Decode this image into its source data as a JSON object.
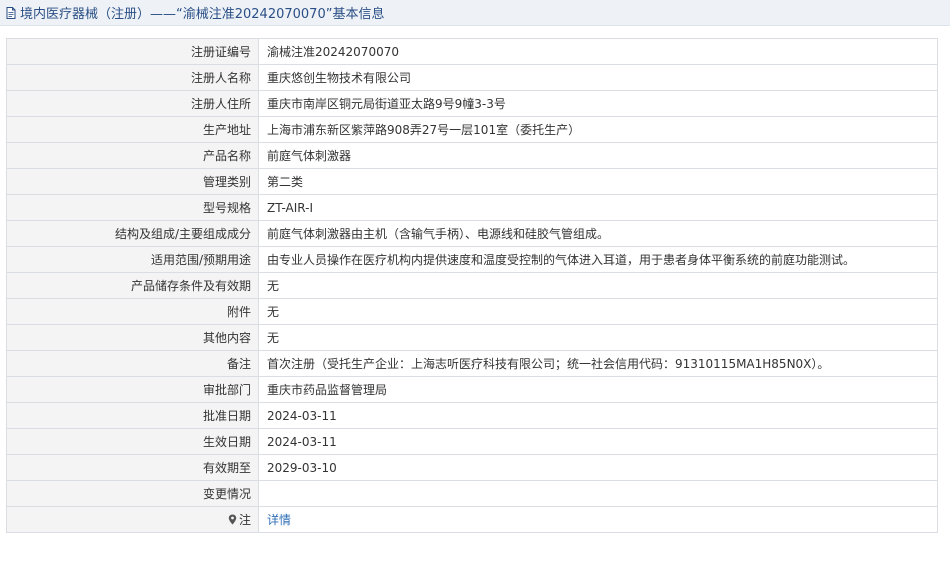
{
  "header": {
    "title": "境内医疗器械（注册）——“渝械注准20242070070”基本信息",
    "icon": "document-icon"
  },
  "rows": [
    {
      "label": "注册证编号",
      "value": "渝械注准20242070070"
    },
    {
      "label": "注册人名称",
      "value": "重庆悠创生物技术有限公司"
    },
    {
      "label": "注册人住所",
      "value": "重庆市南岸区铜元局街道亚太路9号9幢3-3号"
    },
    {
      "label": "生产地址",
      "value": "上海市浦东新区紫萍路908弄27号一层101室（委托生产）"
    },
    {
      "label": "产品名称",
      "value": "前庭气体刺激器"
    },
    {
      "label": "管理类别",
      "value": "第二类"
    },
    {
      "label": "型号规格",
      "value": "ZT-AIR-I"
    },
    {
      "label": "结构及组成/主要组成成分",
      "value": "前庭气体刺激器由主机（含输气手柄）、电源线和硅胶气管组成。"
    },
    {
      "label": "适用范围/预期用途",
      "value": "由专业人员操作在医疗机构内提供速度和温度受控制的气体进入耳道，用于患者身体平衡系统的前庭功能测试。"
    },
    {
      "label": "产品储存条件及有效期",
      "value": "无"
    },
    {
      "label": "附件",
      "value": "无"
    },
    {
      "label": "其他内容",
      "value": "无"
    },
    {
      "label": "备注",
      "value": "首次注册（受托生产企业：上海志听医疗科技有限公司；统一社会信用代码：91310115MA1H85N0X）。"
    },
    {
      "label": "审批部门",
      "value": "重庆市药品监督管理局"
    },
    {
      "label": "批准日期",
      "value": "2024-03-11"
    },
    {
      "label": "生效日期",
      "value": "2024-03-11"
    },
    {
      "label": "有效期至",
      "value": "2029-03-10"
    },
    {
      "label": "变更情况",
      "value": ""
    }
  ],
  "note_row": {
    "label": "注",
    "icon": "map-pin-icon",
    "link_text": "详情"
  }
}
